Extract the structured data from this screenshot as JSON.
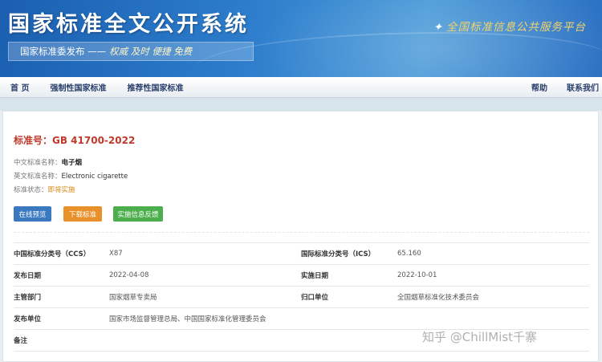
{
  "header": {
    "site_title": "国家标准全文公开系统",
    "slogan_prefix": "国家标准委发布 ——",
    "slogan_values": "权威 及时 便捷 免费",
    "platform_tag": "全国标准信息公共服务平台"
  },
  "nav": {
    "home": "首 页",
    "mandatory": "强制性国家标准",
    "recommended": "推荐性国家标准",
    "help": "帮助",
    "contact": "联系我们"
  },
  "standard": {
    "title": "标准号：GB 41700-2022",
    "cn_name_label": "中文标准名称：",
    "cn_name": "电子烟",
    "en_name_label": "英文标准名称：",
    "en_name": "Electronic cigarette",
    "status_label": "标准状态：",
    "status": "即将实施"
  },
  "buttons": {
    "preview": "在线预览",
    "download": "下载标准",
    "feedback": "实施信息反馈"
  },
  "table": {
    "rows": [
      {
        "k1": "中国标准分类号（CCS）",
        "v1": "X87",
        "k2": "国际标准分类号（ICS）",
        "v2": "65.160"
      },
      {
        "k1": "发布日期",
        "v1": "2022-04-08",
        "k2": "实施日期",
        "v2": "2022-10-01"
      },
      {
        "k1": "主管部门",
        "v1": "国家烟草专卖局",
        "k2": "归口单位",
        "v2": "全国烟草标准化技术委员会"
      },
      {
        "k1": "发布单位",
        "v1": "国家市场监督管理总局、中国国家标准化管理委员会",
        "k2": "",
        "v2": ""
      },
      {
        "k1": "备注",
        "v1": "",
        "k2": "",
        "v2": ""
      }
    ]
  },
  "watermark": "知乎 @ChillMist千寨"
}
